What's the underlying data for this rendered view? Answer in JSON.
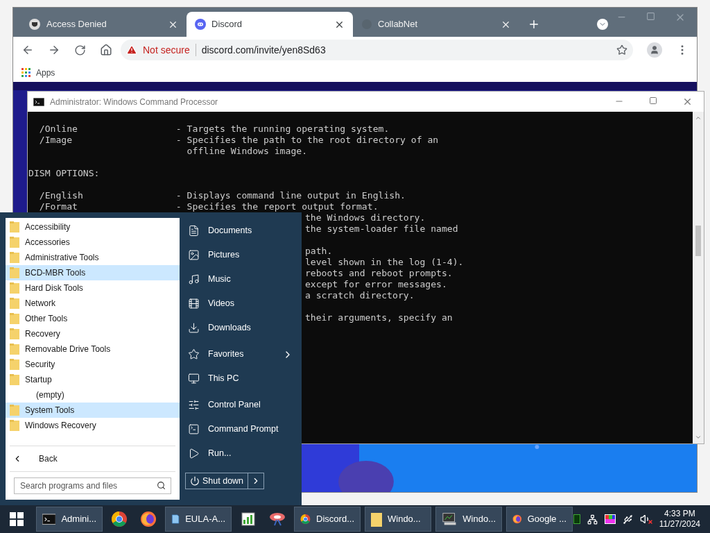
{
  "browser": {
    "tabs": [
      {
        "title": "Access Denied",
        "selected": false
      },
      {
        "title": "Discord",
        "selected": true
      },
      {
        "title": "CollabNet",
        "selected": false
      }
    ],
    "security_label": "Not secure",
    "url": "discord.com/invite/yen8Sd63",
    "bookmarks": [
      "Apps"
    ]
  },
  "console": {
    "title": "Administrator: Windows Command Processor",
    "lines": [
      {
        "kind": "line",
        "text": "  /Online                  - Targets the running operating system."
      },
      {
        "kind": "line",
        "text": "  /Image                   - Specifies the path to the root directory of an"
      },
      {
        "kind": "line",
        "text": "                             offline Windows image."
      },
      {
        "kind": "blank"
      },
      {
        "kind": "line",
        "text": "DISM OPTIONS:"
      },
      {
        "kind": "blank"
      },
      {
        "kind": "line",
        "text": "  /English                 - Displays command line output in English."
      },
      {
        "kind": "line",
        "text": "  /Format                  - Specifies the report output format."
      },
      {
        "kind": "tail",
        "text": "the Windows directory."
      },
      {
        "kind": "tail",
        "text": "the system-loader file named"
      },
      {
        "kind": "blank"
      },
      {
        "kind": "tail",
        "text": "path."
      },
      {
        "kind": "tail",
        "text": "level shown in the log (1-4)."
      },
      {
        "kind": "tail",
        "text": "reboots and reboot prompts."
      },
      {
        "kind": "tail",
        "text": "except for error messages."
      },
      {
        "kind": "tail",
        "text": "a scratch directory."
      },
      {
        "kind": "blank"
      },
      {
        "kind": "tail",
        "text": "their arguments, specify an"
      }
    ]
  },
  "start_menu": {
    "programs": [
      {
        "kind": "folder",
        "label": "Accessibility",
        "highlighted": false
      },
      {
        "kind": "folder",
        "label": "Accessories",
        "highlighted": false
      },
      {
        "kind": "folder",
        "label": "Administrative Tools",
        "highlighted": false
      },
      {
        "kind": "folder",
        "label": "BCD-MBR Tools",
        "highlighted": true
      },
      {
        "kind": "folder",
        "label": "Hard Disk Tools",
        "highlighted": false
      },
      {
        "kind": "folder",
        "label": "Network",
        "highlighted": false
      },
      {
        "kind": "folder",
        "label": "Other Tools",
        "highlighted": false
      },
      {
        "kind": "folder",
        "label": "Recovery",
        "highlighted": false
      },
      {
        "kind": "folder",
        "label": "Removable Drive Tools",
        "highlighted": false
      },
      {
        "kind": "folder",
        "label": "Security",
        "highlighted": false
      },
      {
        "kind": "folder",
        "label": "Startup",
        "highlighted": false
      },
      {
        "kind": "empty",
        "label": "(empty)",
        "highlighted": false
      },
      {
        "kind": "folder",
        "label": "System Tools",
        "highlighted": true
      },
      {
        "kind": "folder",
        "label": "Windows Recovery",
        "highlighted": false
      }
    ],
    "back_label": "Back",
    "search": {
      "placeholder": "Search programs and files"
    },
    "places": [
      {
        "label": "Documents",
        "submenu": false
      },
      {
        "label": "Pictures",
        "submenu": false
      },
      {
        "label": "Music",
        "submenu": false
      },
      {
        "label": "Videos",
        "submenu": false
      },
      {
        "label": "Downloads",
        "submenu": false
      },
      {
        "label": "Favorites",
        "submenu": true
      },
      {
        "label": "This PC",
        "submenu": false
      },
      {
        "label": "Control Panel",
        "submenu": false
      },
      {
        "label": "Command Prompt",
        "submenu": false
      },
      {
        "label": "Run...",
        "submenu": false
      }
    ],
    "shutdown_label": "Shut down"
  },
  "taskbar": {
    "items": [
      {
        "kind": "button",
        "label": "Admini..."
      },
      {
        "kind": "icon"
      },
      {
        "kind": "icon"
      },
      {
        "kind": "button",
        "label": "EULA-A..."
      },
      {
        "kind": "icon"
      },
      {
        "kind": "icon"
      },
      {
        "kind": "button",
        "label": "Discord..."
      },
      {
        "kind": "button",
        "label": "Windo..."
      },
      {
        "kind": "button",
        "label": "Windo..."
      },
      {
        "kind": "button",
        "label": "Google ..."
      }
    ],
    "clock": {
      "time": "4:33 PM",
      "date": "11/27/2024"
    }
  }
}
